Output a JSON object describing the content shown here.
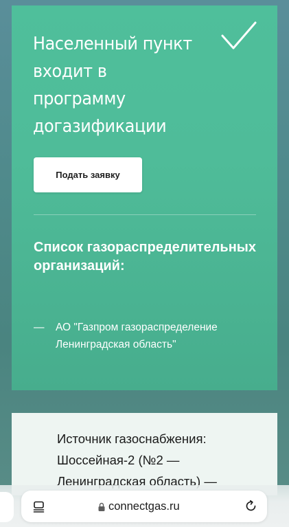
{
  "hero": {
    "title": "Населенный пункт входит в программу догазификации",
    "apply_label": "Подать заявку"
  },
  "organizations": {
    "heading": "Список газораспределительных организаций:",
    "items": [
      {
        "dash": "—",
        "name": "АО \"Газпром газораспределение Ленинградская область\""
      }
    ]
  },
  "source": {
    "text": "Источник газоснабжения: Шоссейная-2 (№2 — Ленинградская область) —"
  },
  "browser": {
    "url": "connectgas.ru",
    "icons": {
      "menu": "page-menu-icon",
      "lock": "lock-icon",
      "reload": "reload-icon"
    }
  },
  "colors": {
    "hero_green": "#4fbc99",
    "card_bg": "#eef5f2",
    "page_bg": "#4f8a8b"
  }
}
